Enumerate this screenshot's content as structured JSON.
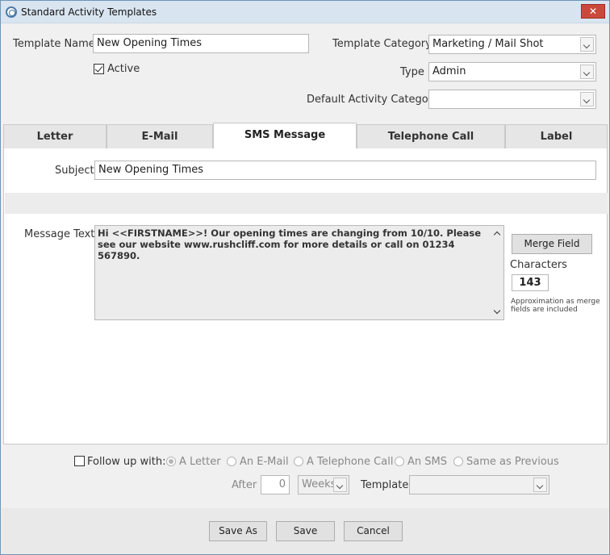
{
  "window": {
    "title": "Standard Activity Templates",
    "close_label": "✕"
  },
  "form": {
    "template_name_label": "Template Name",
    "template_name_value": "New Opening Times",
    "active_label": "Active",
    "template_category_label": "Template Category",
    "template_category_value": "Marketing / Mail Shot",
    "type_label": "Type",
    "type_value": "Admin",
    "default_activity_category_label": "Default Activity Category",
    "default_activity_category_value": ""
  },
  "tabs": [
    {
      "label": "Letter"
    },
    {
      "label": "E-Mail"
    },
    {
      "label": "SMS Message"
    },
    {
      "label": "Telephone Call"
    },
    {
      "label": "Label"
    }
  ],
  "sms": {
    "subject_label": "Subject",
    "subject_value": "New Opening Times",
    "message_text_label": "Message Text",
    "message_text_value": "Hi <<FIRSTNAME>>! Our opening times are changing from 10/10. Please see our website www.rushcliff.com for more details or call on 01234 567890.",
    "merge_field_label": "Merge Field",
    "characters_label": "Characters",
    "characters_value": "143",
    "approx_note": "Approximation as merge fields are included"
  },
  "followup": {
    "follow_up_label": "Follow up with:",
    "options": [
      {
        "label": "A Letter",
        "selected": true
      },
      {
        "label": "An E-Mail",
        "selected": false
      },
      {
        "label": "A Telephone Call",
        "selected": false
      },
      {
        "label": "An SMS",
        "selected": false
      },
      {
        "label": "Same as Previous",
        "selected": false
      }
    ],
    "after_label": "After",
    "after_value": "0",
    "unit_value": "Weeks",
    "template_label": "Template",
    "template_value": ""
  },
  "buttons": {
    "save_as": "Save As",
    "save": "Save",
    "cancel": "Cancel"
  },
  "colors": {
    "titlebar": "#d8e4f0",
    "close_button": "#c94a3c",
    "window_border": "#6f95b5"
  }
}
